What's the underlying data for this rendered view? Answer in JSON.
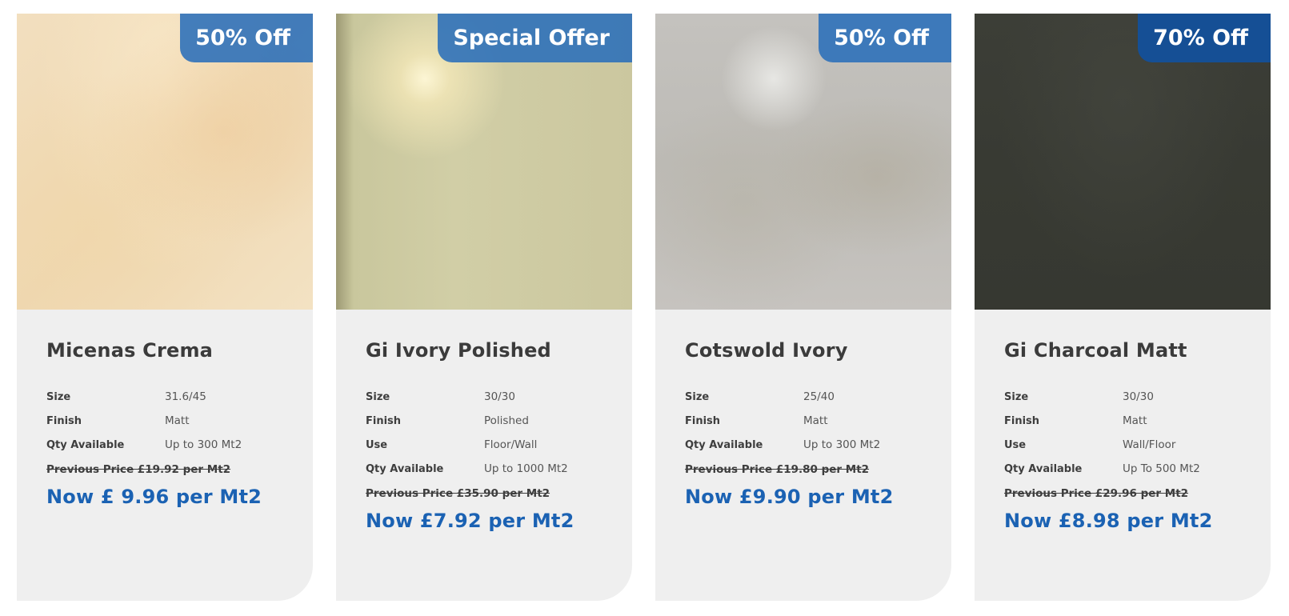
{
  "colors": {
    "badge_blue": "#2a6eb9",
    "badge_dark_blue": "#154f95",
    "price_blue": "#1b62b3",
    "card_bg": "#efefef"
  },
  "products": [
    {
      "badge": "50% Off",
      "name": "Micenas Crema",
      "specs": [
        {
          "label": "Size",
          "value": "31.6/45"
        },
        {
          "label": "Finish",
          "value": "Matt"
        },
        {
          "label": "Qty Available",
          "value": "Up to 300 Mt2"
        }
      ],
      "previous_price": "Previous Price £19.92 per Mt2",
      "now_price": "Now £ 9.96 per Mt2"
    },
    {
      "badge": "Special Offer",
      "name": "Gi Ivory Polished",
      "specs": [
        {
          "label": "Size",
          "value": "30/30"
        },
        {
          "label": "Finish",
          "value": "Polished"
        },
        {
          "label": "Use",
          "value": "Floor/Wall"
        },
        {
          "label": "Qty Available",
          "value": "Up to 1000 Mt2"
        }
      ],
      "previous_price": "Previous Price £35.90 per Mt2",
      "now_price": "Now £7.92 per Mt2"
    },
    {
      "badge": "50% Off",
      "name": "Cotswold Ivory",
      "specs": [
        {
          "label": "Size",
          "value": "25/40"
        },
        {
          "label": "Finish",
          "value": "Matt"
        },
        {
          "label": "Qty Available",
          "value": "Up to 300 Mt2"
        }
      ],
      "previous_price": "Previous Price £19.80 per Mt2",
      "now_price": "Now £9.90 per Mt2"
    },
    {
      "badge": "70% Off",
      "name": "Gi Charcoal Matt",
      "specs": [
        {
          "label": "Size",
          "value": "30/30"
        },
        {
          "label": "Finish",
          "value": "Matt"
        },
        {
          "label": "Use",
          "value": "Wall/Floor"
        },
        {
          "label": "Qty Available",
          "value": "Up To 500 Mt2"
        }
      ],
      "previous_price": "Previous Price £29.96 per Mt2",
      "now_price": "Now £8.98 per Mt2"
    }
  ]
}
